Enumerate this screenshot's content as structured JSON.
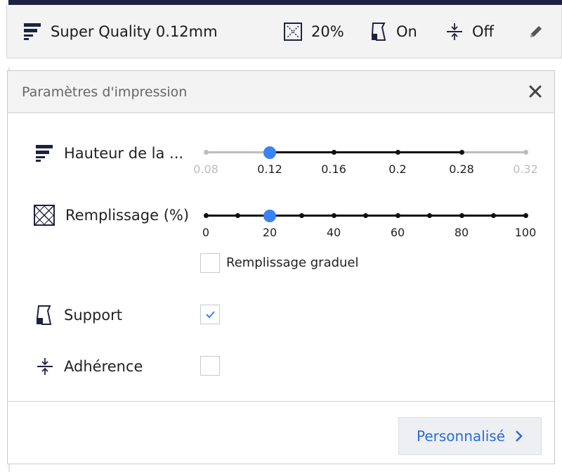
{
  "header": {
    "profile_label": "Super Quality 0.12mm",
    "infill_value": "20%",
    "support_value": "On",
    "adhesion_value": "Off",
    "icons": [
      "layer-height-icon",
      "infill-icon",
      "support-icon",
      "adhesion-icon",
      "pencil-icon"
    ]
  },
  "panel": {
    "title": "Paramètres d'impression",
    "close_icon": "close-icon",
    "layer_height": {
      "label": "Hauteur de la ...",
      "options": [
        "0.08",
        "0.12",
        "0.16",
        "0.2",
        "0.28",
        "0.32"
      ],
      "selected": "0.12",
      "enabled_range": [
        "0.12",
        "0.28"
      ]
    },
    "infill": {
      "label": "Remplissage (%)",
      "ticks": [
        "0",
        "20",
        "40",
        "60",
        "80",
        "100"
      ],
      "min": 0,
      "max": 100,
      "step": 10,
      "value": 20
    },
    "gradual_infill": {
      "label": "Remplissage graduel",
      "checked": false
    },
    "support": {
      "label": "Support",
      "checked": true
    },
    "adhesion": {
      "label": "Adhérence",
      "checked": false
    },
    "custom_button": "Personnalisé"
  },
  "colors": {
    "accent": "#3b82f6",
    "link": "#2a6bd8",
    "header_bg": "#f3f3f3",
    "dark_strip": "#1f2142"
  }
}
